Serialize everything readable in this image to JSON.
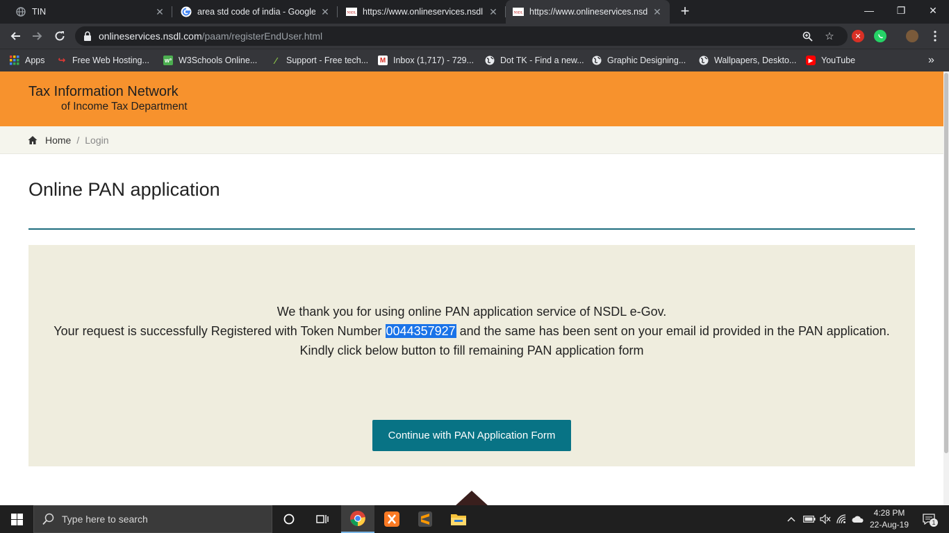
{
  "browser": {
    "tabs": [
      {
        "title": "TIN",
        "favicon": "globe-icon",
        "active": false
      },
      {
        "title": "area std code of india - Google S",
        "favicon": "google-icon",
        "active": false
      },
      {
        "title": "https://www.onlineservices.nsdl.c",
        "favicon": "nsdl-icon",
        "active": false
      },
      {
        "title": "https://www.onlineservices.nsdl.c",
        "favicon": "nsdl-icon",
        "active": true
      }
    ],
    "new_tab_label": "+",
    "window_controls": {
      "minimize": "—",
      "restore": "❐",
      "close": "✕"
    },
    "address": {
      "host": "onlineservices.nsdl.com",
      "path": "/paam/registerEndUser.html"
    },
    "bookmarks": [
      {
        "label": "Apps",
        "icon": "apps-grid-icon"
      },
      {
        "label": "Free Web Hosting...",
        "icon": "hosting-icon"
      },
      {
        "label": "W3Schools Online...",
        "icon": "w3schools-icon"
      },
      {
        "label": "Support - Free tech...",
        "icon": "support-icon"
      },
      {
        "label": "Inbox (1,717) - 729...",
        "icon": "gmail-icon"
      },
      {
        "label": "Dot TK - Find a new...",
        "icon": "globe-icon"
      },
      {
        "label": "Graphic Designing...",
        "icon": "globe-icon"
      },
      {
        "label": "Wallpapers, Deskto...",
        "icon": "globe-icon"
      },
      {
        "label": "YouTube",
        "icon": "youtube-icon"
      }
    ],
    "bookmarks_overflow": "»"
  },
  "site": {
    "logo_line1": "Tax Information Network",
    "logo_line2": "of Income Tax Department",
    "breadcrumb": {
      "home": "Home",
      "separator": "/",
      "current": "Login"
    },
    "page_title": "Online PAN application",
    "message": {
      "line1": "We thank you for using online PAN application service of NSDL e-Gov.",
      "line2_before": "Your request is successfully Registered with Token Number ",
      "token": "0044357927",
      "line2_after": " and the same has been sent on your email id provided in the PAN application.",
      "line3": "Kindly click below button to fill remaining PAN application form"
    },
    "cta_label": "Continue with PAN Application Form",
    "colors": {
      "header": "#f7922d",
      "panel": "#efedde",
      "button": "#087385",
      "rule": "#1d6c7e"
    }
  },
  "taskbar": {
    "search_placeholder": "Type here to search",
    "apps": [
      "cortana-icon",
      "task-view-icon",
      "chrome-icon",
      "xampp-icon",
      "sublime-icon",
      "file-explorer-icon"
    ],
    "time": "4:28 PM",
    "date": "22-Aug-19",
    "notification_count": "1"
  }
}
